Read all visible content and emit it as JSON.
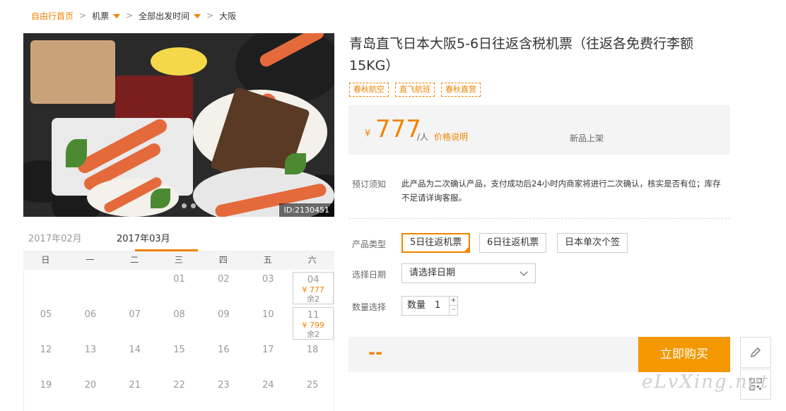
{
  "breadcrumb": {
    "home": "自由行首页",
    "category": "机票",
    "time": "全部出发时间",
    "destination": "大阪"
  },
  "hero": {
    "id_label": "ID:2130451"
  },
  "product": {
    "title": "青岛直飞日本大阪5-6日往返含税机票（往返各免费行李额15KG）",
    "tags": [
      "春秋航空",
      "直飞航班",
      "春秋直营"
    ]
  },
  "price": {
    "currency": "¥",
    "amount": "777",
    "unit": "/人",
    "explain": "价格说明",
    "new_label": "新品上架"
  },
  "notice": {
    "label": "预订须知",
    "text": "此产品为二次确认产品，支付成功后24小时内商家将进行二次确认，核实是否有位；库存不足请详询客服。"
  },
  "options": {
    "type_label": "产品类型",
    "types": [
      "5日往返机票",
      "6日往返机票",
      "日本单次个签"
    ],
    "date_label": "选择日期",
    "date_placeholder": "请选择日期",
    "qty_label": "数量选择",
    "qty_prefix": "数量",
    "qty_value": "1"
  },
  "buy": {
    "total": "--",
    "button": "立即购买"
  },
  "watermark": "eLvXing.net",
  "calendar": {
    "tabs": [
      "2017年02月",
      "2017年03月"
    ],
    "weekdays": [
      "日",
      "一",
      "二",
      "三",
      "四",
      "五",
      "六"
    ],
    "rows": [
      [
        "",
        "",
        "",
        "01",
        "02",
        "03",
        "04"
      ],
      [
        "05",
        "06",
        "07",
        "08",
        "09",
        "10",
        "11"
      ],
      [
        "12",
        "13",
        "14",
        "15",
        "16",
        "17",
        "18"
      ],
      [
        "19",
        "20",
        "21",
        "22",
        "23",
        "24",
        "25"
      ]
    ],
    "available": [
      {
        "day": "04",
        "price": "¥ 777",
        "left": "余2"
      },
      {
        "day": "11",
        "price": "¥ 799",
        "left": "余2"
      }
    ]
  }
}
